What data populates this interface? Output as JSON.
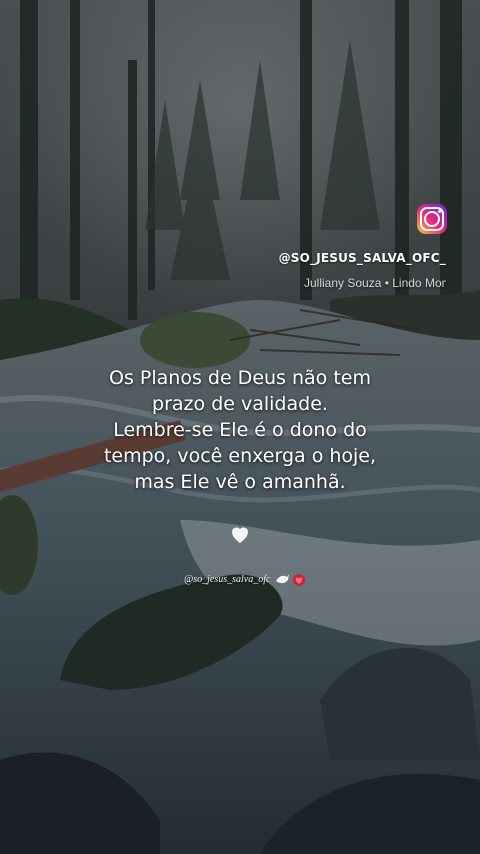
{
  "overlay": {
    "instagram_icon": "instagram-icon",
    "handle": "@SO_JESUS_SALVA_OFC_",
    "audio_line": "Julliany Souza • Lindo Mom"
  },
  "quote": {
    "lines": [
      "Os Planos de Deus não tem",
      "prazo de validade.",
      "Lembre-se Ele é o dono do",
      "tempo, você enxerga o hoje,",
      "mas Ele vê o amanhã."
    ]
  },
  "decor": {
    "heart_icon": "white-heart-icon",
    "watermark": "@so_jesus_salva_ofc",
    "watermark_icons": [
      "dove-icon",
      "heart-wreath-icon"
    ]
  },
  "colors": {
    "text": "#ffffff",
    "instagram_gradient": [
      "#f9ce34",
      "#ee2a7b",
      "#6228d7"
    ]
  }
}
